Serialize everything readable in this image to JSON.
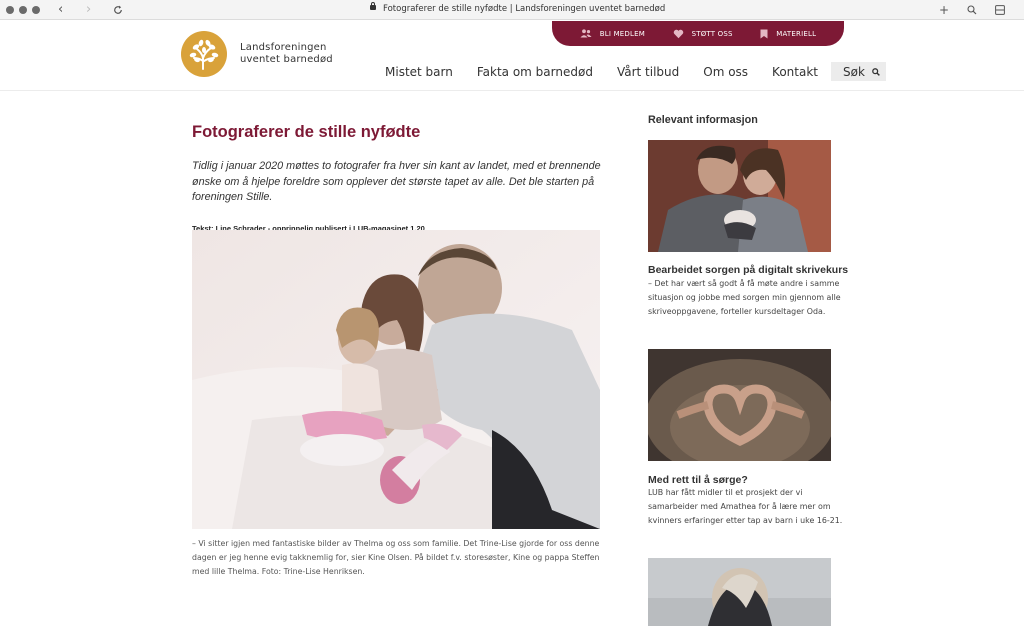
{
  "browser": {
    "tab_title": "Fotograferer de stille nyfødte | Landsforeningen uventet barnedød",
    "icons": [
      "back-arrow",
      "forward-arrow",
      "reload",
      "lock",
      "new-tab",
      "search",
      "sidebar"
    ]
  },
  "header": {
    "logo_line1": "Landsforeningen",
    "logo_line2": "uventet barnedød",
    "topbar": [
      {
        "label": "BLI MEDLEM",
        "icon": "people-icon"
      },
      {
        "label": "STØTT OSS",
        "icon": "heart-icon"
      },
      {
        "label": "MATERIELL",
        "icon": "bookmark-icon"
      }
    ],
    "nav": [
      "Mistet barn",
      "Fakta om barnedød",
      "Vårt tilbud",
      "Om oss",
      "Kontakt"
    ],
    "search_label": "Søk"
  },
  "article": {
    "title": "Fotograferer de stille nyfødte",
    "lead": "Tidlig i januar 2020 møttes to fotografer fra hver sin kant av landet, med et brennende ønske om å hjelpe foreldre som opplever det største tapet av alle. Det ble starten på foreningen Stille.",
    "byline": "Tekst: Line Schrader - opprinnelig publisert i LUB-magasinet 1.20",
    "caption": "– Vi sitter igjen med fantastiske bilder av Thelma og oss som familie. Det Trine-Lise gjorde for oss denne dagen er jeg henne evig takknemlig for, sier Kine Olsen. På bildet f.v. storesøster, Kine og pappa Steffen med lille Thelma. Foto: Trine-Lise Henriksen."
  },
  "sidebar": {
    "heading": "Relevant informasjon",
    "cards": [
      {
        "title": "Bearbeidet sorgen på digitalt skrivekurs",
        "text": "– Det har vært så godt å få møte andre i samme situasjon og jobbe med sorgen min gjennom alle skriveoppgavene, forteller kursdeltager Oda."
      },
      {
        "title": "Med rett til å sørge?",
        "text": "LUB har fått midler til et prosjekt der vi samarbeider med Amathea for å lære mer om kvinners erfaringer etter tap av barn i uke 16-21."
      }
    ]
  },
  "colors": {
    "brand": "#7d1935",
    "logo": "#d9a23a",
    "search_bg": "#ececec"
  }
}
